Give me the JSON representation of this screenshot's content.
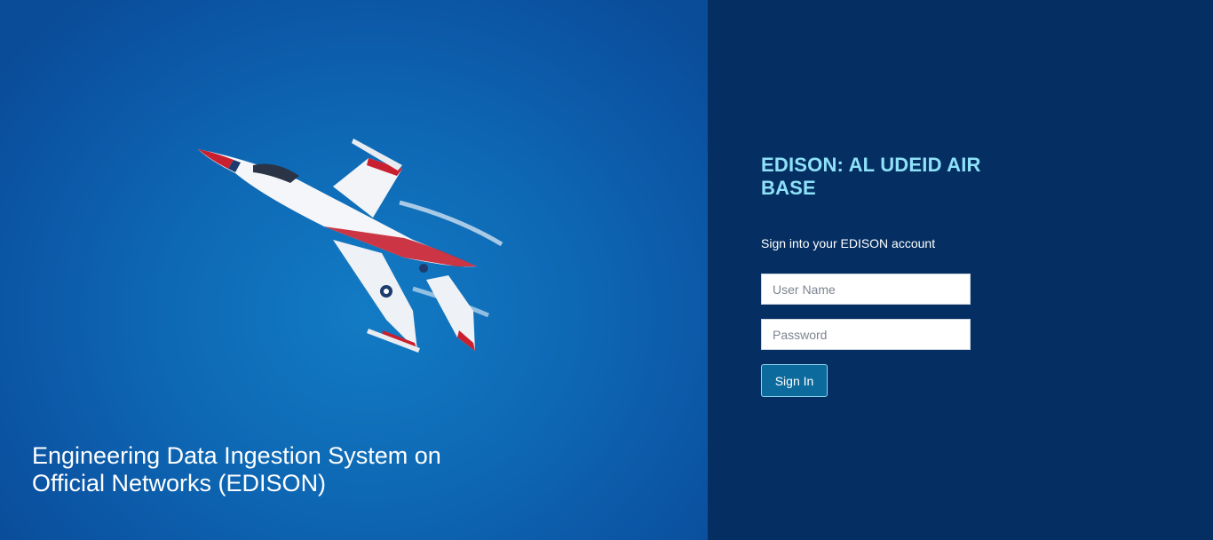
{
  "hero": {
    "caption": "Engineering Data Ingestion System on Official Networks (EDISON)",
    "image": "fighter-jet-photo"
  },
  "auth": {
    "title": "EDISON: AL UDEID AIR BASE",
    "subtitle": "Sign into your EDISON account",
    "username_placeholder": "User Name",
    "password_placeholder": "Password",
    "signin_label": "Sign In"
  },
  "colors": {
    "hero_blue": "#0e68b4",
    "panel_navy": "#052f63",
    "title_cyan": "#8ee2f8",
    "button_blue": "#0c6a9d"
  }
}
